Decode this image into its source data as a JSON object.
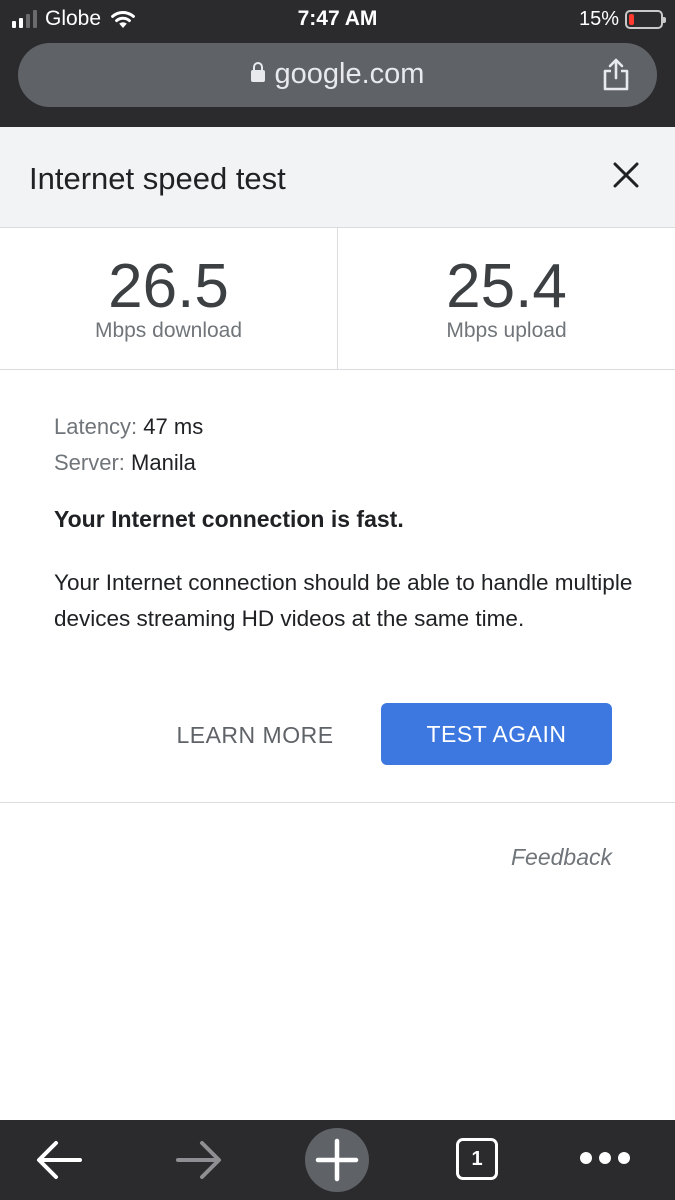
{
  "status_bar": {
    "carrier": "Globe",
    "time": "7:47 AM",
    "battery_percent": "15%",
    "battery_level": 0.15,
    "battery_color": "#ff3b30"
  },
  "browser": {
    "url": "google.com",
    "lock_icon": "lock-icon",
    "share_icon": "share-icon"
  },
  "card": {
    "title": "Internet speed test",
    "close_icon": "close-icon",
    "download": {
      "value": "26.5",
      "unit": "Mbps download"
    },
    "upload": {
      "value": "25.4",
      "unit": "Mbps upload"
    },
    "latency": {
      "label": "Latency:",
      "value": "47 ms"
    },
    "server": {
      "label": "Server:",
      "value": "Manila"
    },
    "verdict": "Your Internet connection is fast.",
    "description": "Your Internet connection should be able to handle multiple devices streaming HD videos at the same time.",
    "learn_more_label": "LEARN MORE",
    "test_again_label": "TEST AGAIN",
    "accent_color": "#3c78e0",
    "feedback_label": "Feedback"
  },
  "toolbar": {
    "tab_count": "1",
    "icons": [
      "back-arrow-icon",
      "forward-arrow-icon",
      "plus-icon",
      "tab-switcher-icon",
      "more-dots-icon"
    ]
  }
}
